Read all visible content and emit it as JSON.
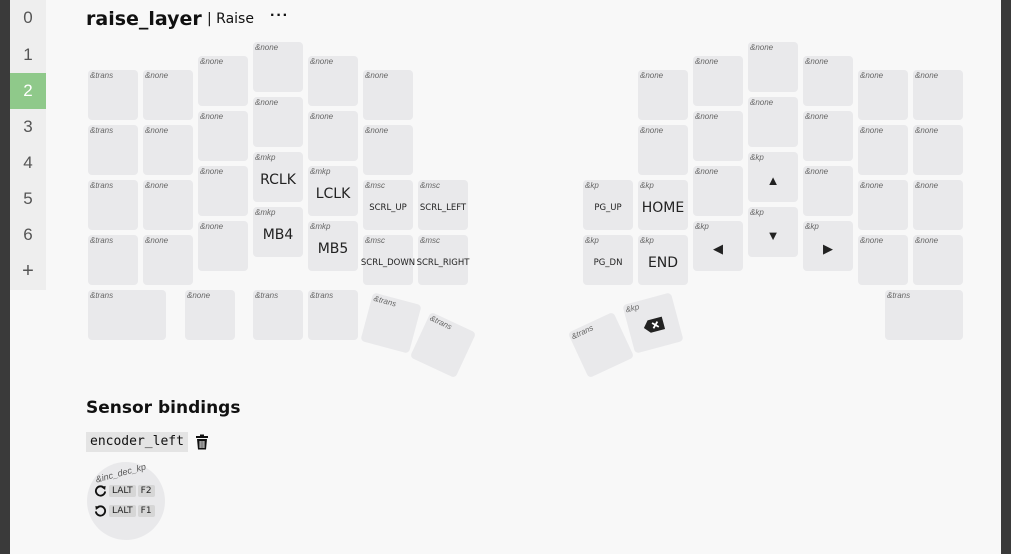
{
  "sidebar": {
    "layers": [
      "0",
      "1",
      "2",
      "3",
      "4",
      "5",
      "6"
    ],
    "active_index": 2,
    "add_label": "+"
  },
  "layer": {
    "title": "raise_layer",
    "name": "| Raise",
    "menu": "···"
  },
  "keys": {
    "l_c0_r0": {
      "behavior": "&trans",
      "param": ""
    },
    "l_c0_r1": {
      "behavior": "&trans",
      "param": ""
    },
    "l_c0_r2": {
      "behavior": "&trans",
      "param": ""
    },
    "l_c0_r3": {
      "behavior": "&trans",
      "param": ""
    },
    "l_c1_r0": {
      "behavior": "&none",
      "param": ""
    },
    "l_c1_r1": {
      "behavior": "&none",
      "param": ""
    },
    "l_c1_r2": {
      "behavior": "&none",
      "param": ""
    },
    "l_c1_r3": {
      "behavior": "&none",
      "param": ""
    },
    "l_c2_r0": {
      "behavior": "&none",
      "param": ""
    },
    "l_c2_r1": {
      "behavior": "&none",
      "param": ""
    },
    "l_c2_r2": {
      "behavior": "&none",
      "param": ""
    },
    "l_c2_r3": {
      "behavior": "&none",
      "param": ""
    },
    "l_c3_r0": {
      "behavior": "&none",
      "param": ""
    },
    "l_c3_r1": {
      "behavior": "&none",
      "param": ""
    },
    "l_c3_r2": {
      "behavior": "&mkp",
      "param": "RCLK"
    },
    "l_c3_r3": {
      "behavior": "&mkp",
      "param": "MB4"
    },
    "l_c4_r0": {
      "behavior": "&none",
      "param": ""
    },
    "l_c4_r1": {
      "behavior": "&none",
      "param": ""
    },
    "l_c4_r2": {
      "behavior": "&mkp",
      "param": "LCLK"
    },
    "l_c4_r3": {
      "behavior": "&mkp",
      "param": "MB5"
    },
    "l_c5_r0": {
      "behavior": "&none",
      "param": ""
    },
    "l_c5_r1": {
      "behavior": "&none",
      "param": ""
    },
    "l_c5_r2": {
      "behavior": "&msc",
      "param": "SCRL_UP"
    },
    "l_c5_r3": {
      "behavior": "&msc",
      "param": "SCRL_DOWN"
    },
    "l_c6_r2": {
      "behavior": "&msc",
      "param": "SCRL_LEFT"
    },
    "l_c6_r3": {
      "behavior": "&msc",
      "param": "SCRL_RIGHT"
    },
    "l_th0": {
      "behavior": "&trans",
      "param": ""
    },
    "l_th1": {
      "behavior": "&none",
      "param": ""
    },
    "l_th2": {
      "behavior": "&trans",
      "param": ""
    },
    "l_th3": {
      "behavior": "&trans",
      "param": ""
    },
    "l_th4": {
      "behavior": "&trans",
      "param": ""
    },
    "l_th5": {
      "behavior": "&trans",
      "param": ""
    },
    "r_c0_r2": {
      "behavior": "&kp",
      "param": "PG_UP"
    },
    "r_c0_r3": {
      "behavior": "&kp",
      "param": "PG_DN"
    },
    "r_c1_r0": {
      "behavior": "&none",
      "param": ""
    },
    "r_c1_r1": {
      "behavior": "&none",
      "param": ""
    },
    "r_c1_r2": {
      "behavior": "&kp",
      "param": "HOME"
    },
    "r_c1_r3": {
      "behavior": "&kp",
      "param": "END"
    },
    "r_c2_r0": {
      "behavior": "&none",
      "param": ""
    },
    "r_c2_r1": {
      "behavior": "&none",
      "param": ""
    },
    "r_c2_r2": {
      "behavior": "&none",
      "param": ""
    },
    "r_c2_r3": {
      "behavior": "&kp",
      "param": "◀"
    },
    "r_c3_r0": {
      "behavior": "&none",
      "param": ""
    },
    "r_c3_r1": {
      "behavior": "&none",
      "param": ""
    },
    "r_c3_r2": {
      "behavior": "&kp",
      "param": "▲"
    },
    "r_c3_r3": {
      "behavior": "&kp",
      "param": "▼"
    },
    "r_c4_r0": {
      "behavior": "&none",
      "param": ""
    },
    "r_c4_r1": {
      "behavior": "&none",
      "param": ""
    },
    "r_c4_r2": {
      "behavior": "&none",
      "param": ""
    },
    "r_c4_r3": {
      "behavior": "&kp",
      "param": "▶"
    },
    "r_c5_r0": {
      "behavior": "&none",
      "param": ""
    },
    "r_c5_r1": {
      "behavior": "&none",
      "param": ""
    },
    "r_c5_r2": {
      "behavior": "&none",
      "param": ""
    },
    "r_c5_r3": {
      "behavior": "&none",
      "param": ""
    },
    "r_c6_r0": {
      "behavior": "&none",
      "param": ""
    },
    "r_c6_r1": {
      "behavior": "&none",
      "param": ""
    },
    "r_c6_r2": {
      "behavior": "&none",
      "param": ""
    },
    "r_c6_r3": {
      "behavior": "&none",
      "param": ""
    },
    "r_th0": {
      "behavior": "&trans",
      "param": ""
    },
    "r_th1": {
      "behavior": "&kp",
      "param": "backspace-icon"
    },
    "r_th2": {
      "behavior": "&trans",
      "param": ""
    }
  },
  "sensors": {
    "title": "Sensor bindings",
    "encoder_name": "encoder_left",
    "encoder_behavior": "&inc_dec_kp",
    "cw": {
      "mod": "LALT",
      "key": "F2"
    },
    "ccw": {
      "mod": "LALT",
      "key": "F1"
    }
  },
  "colors": {
    "active_layer": "#8fc98a",
    "key_bg": "#e9e9eb"
  }
}
